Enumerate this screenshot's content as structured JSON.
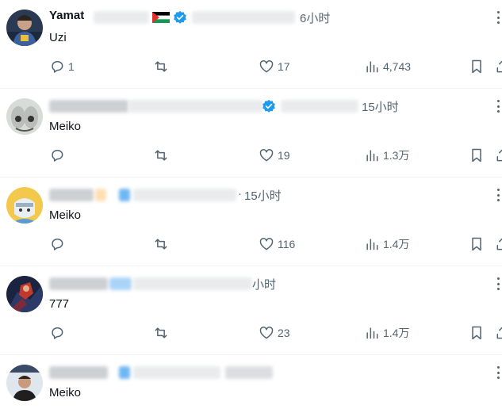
{
  "tweets": [
    {
      "display_name_partial": "Yamat",
      "time": "6小时",
      "text": "Uzi",
      "replies": "1",
      "likes": "17",
      "views": "4,743"
    },
    {
      "time": "15小时",
      "text": "Meiko",
      "replies": "",
      "likes": "19",
      "views": "1.3万"
    },
    {
      "time": "15小时",
      "text": "Meiko",
      "replies": "",
      "likes": "116",
      "views": "1.4万"
    },
    {
      "time": "小时",
      "text": "777",
      "replies": "",
      "likes": "23",
      "views": "1.4万"
    },
    {
      "time": "",
      "text": "Meiko",
      "replies": "",
      "likes": "",
      "views": ""
    }
  ],
  "icons": {
    "reply": "reply-icon",
    "retweet": "retweet-icon",
    "like": "heart-icon",
    "views": "views-icon",
    "bookmark": "bookmark-icon",
    "share": "share-icon",
    "more": "more-icon",
    "verified": "verified-badge-icon",
    "flag": "palestine-flag-icon"
  },
  "colors": {
    "text_primary": "#0f1419",
    "text_secondary": "#536471",
    "verified_blue": "#1d9bf0",
    "divider": "#eff3f4"
  }
}
